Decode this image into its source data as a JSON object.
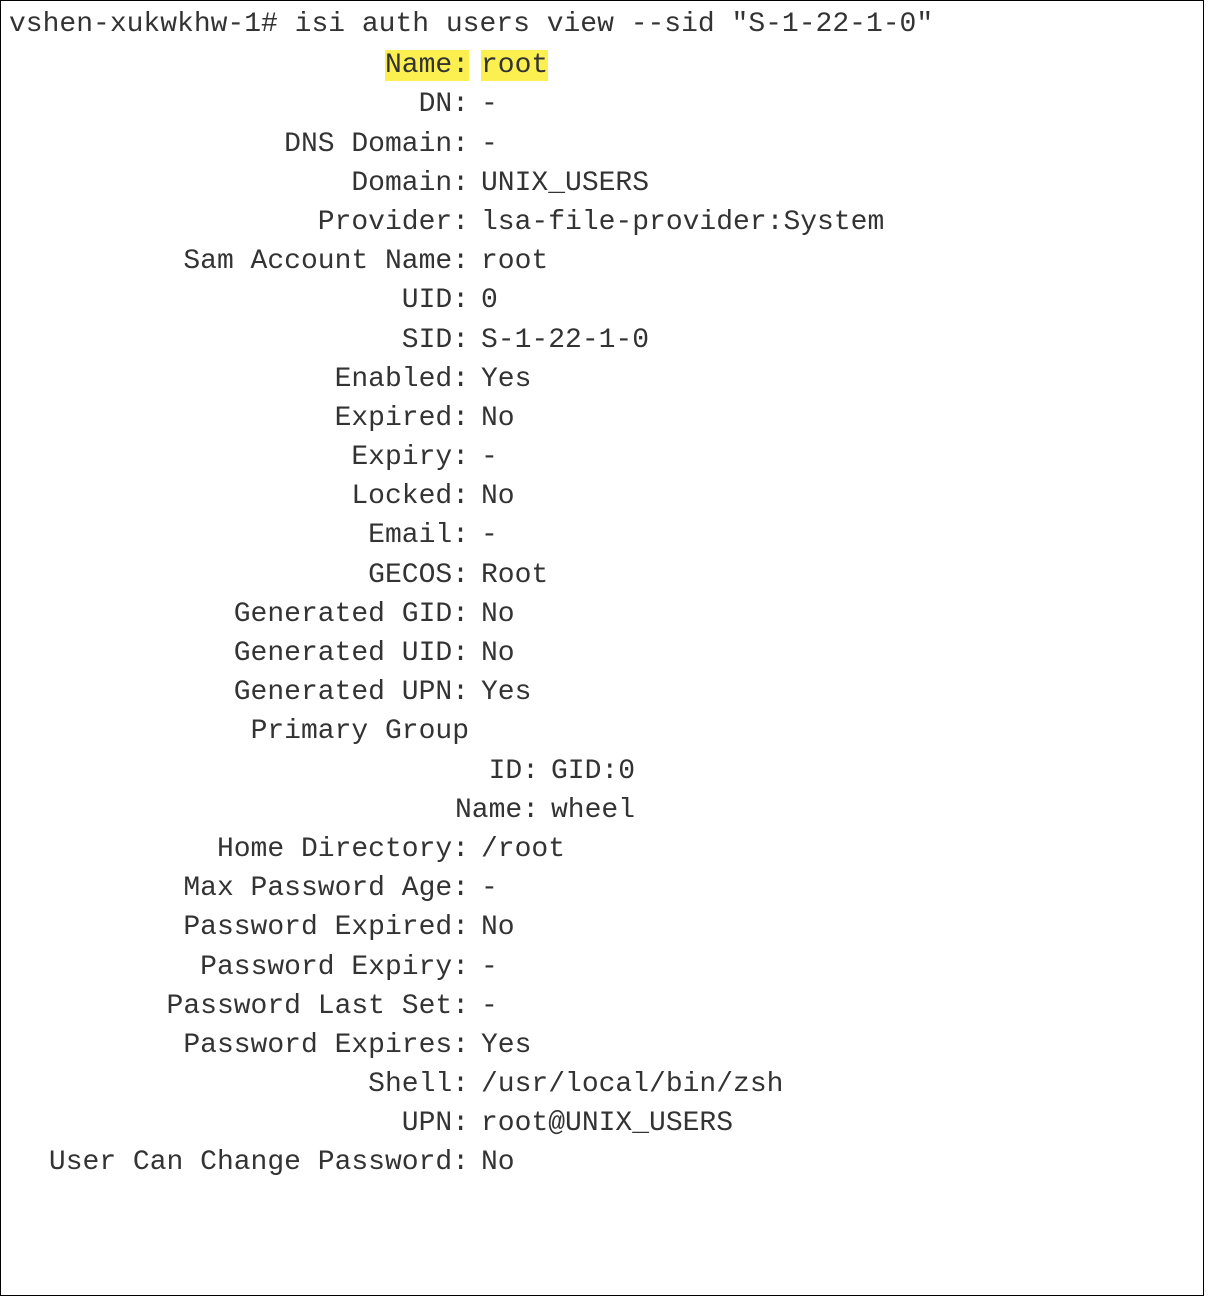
{
  "prompt": "vshen-xukwkhw-1# isi auth users view --sid \"S-1-22-1-0\"",
  "fields": {
    "name_label": "Name:",
    "name_value": "root",
    "dn_label": "DN:",
    "dn_value": "-",
    "dns_domain_label": "DNS Domain:",
    "dns_domain_value": "-",
    "domain_label": "Domain:",
    "domain_value": "UNIX_USERS",
    "provider_label": "Provider:",
    "provider_value": "lsa-file-provider:System",
    "sam_label": "Sam Account Name:",
    "sam_value": "root",
    "uid_label": "UID:",
    "uid_value": "0",
    "sid_label": "SID:",
    "sid_value": "S-1-22-1-0",
    "enabled_label": "Enabled:",
    "enabled_value": "Yes",
    "expired_label": "Expired:",
    "expired_value": "No",
    "expiry_label": "Expiry:",
    "expiry_value": "-",
    "locked_label": "Locked:",
    "locked_value": "No",
    "email_label": "Email:",
    "email_value": "-",
    "gecos_label": "GECOS:",
    "gecos_value": "Root",
    "gen_gid_label": "Generated GID:",
    "gen_gid_value": "No",
    "gen_uid_label": "Generated UID:",
    "gen_uid_value": "No",
    "gen_upn_label": "Generated UPN:",
    "gen_upn_value": "Yes",
    "primary_group_label": "Primary Group",
    "primary_group_value": "",
    "pg_id_label": "ID:",
    "pg_id_value": "GID:0",
    "pg_name_label": "Name:",
    "pg_name_value": "wheel",
    "home_dir_label": "Home Directory:",
    "home_dir_value": "/root",
    "max_pw_age_label": "Max Password Age:",
    "max_pw_age_value": "-",
    "pw_expired_label": "Password Expired:",
    "pw_expired_value": "No",
    "pw_expiry_label": "Password Expiry:",
    "pw_expiry_value": "-",
    "pw_last_set_label": "Password Last Set:",
    "pw_last_set_value": "-",
    "pw_expires_label": "Password Expires:",
    "pw_expires_value": "Yes",
    "shell_label": "Shell:",
    "shell_value": "/usr/local/bin/zsh",
    "upn_label": "UPN:",
    "upn_value": "root@UNIX_USERS",
    "user_can_change_label": "User Can Change Password:",
    "user_can_change_value": "No"
  }
}
